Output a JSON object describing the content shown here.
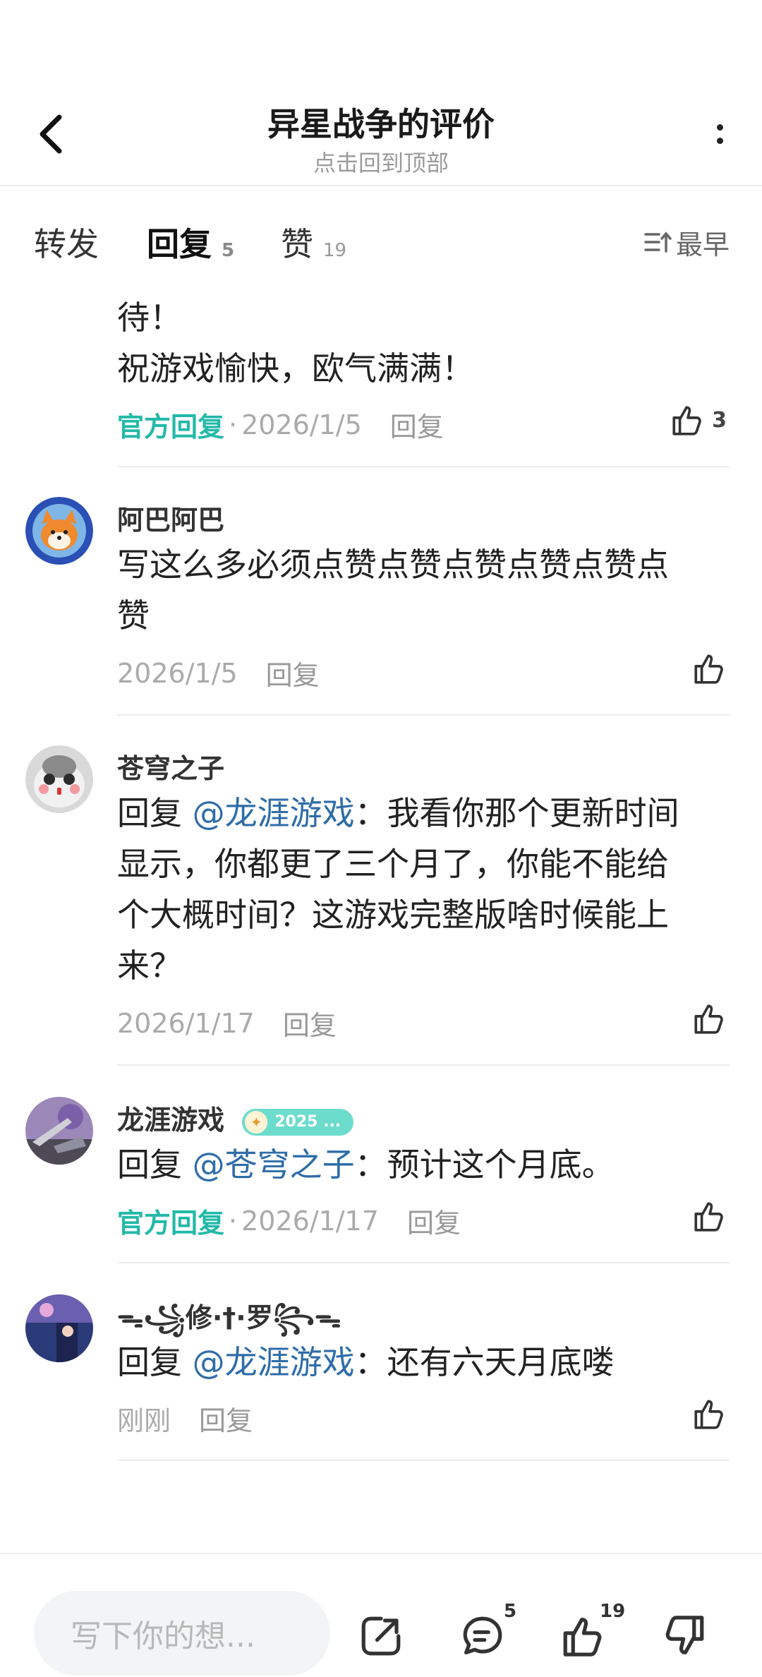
{
  "header": {
    "title": "异星战争的评价",
    "subtitle": "点击回到顶部"
  },
  "tabs": [
    {
      "label": "转发",
      "count": ""
    },
    {
      "label": "回复",
      "count": "5"
    },
    {
      "label": "赞",
      "count": "19"
    }
  ],
  "sort": {
    "label": "最早"
  },
  "comments": [
    {
      "text_lines": [
        "待！",
        "祝游戏愉快，欧气满满！"
      ],
      "official": "官方回复",
      "date": "2026/1/5",
      "reply": "回复",
      "likes": "3"
    },
    {
      "name": "阿巴阿巴",
      "text_lines": [
        "写这么多必须点赞点赞点赞点赞点赞点",
        "赞"
      ],
      "date": "2026/1/5",
      "reply": "回复"
    },
    {
      "name": "苍穹之子",
      "reply_prefix": "回复",
      "mention": "@龙涯游戏",
      "text_first": "：我看你那个更新时间",
      "text_lines": [
        "显示，你都更了三个月了，你能不能给",
        "个大概时间？这游戏完整版啥时候能上",
        "来？"
      ],
      "date": "2026/1/17",
      "reply": "回复"
    },
    {
      "name": "龙涯游戏",
      "badge": "2025 ...",
      "reply_prefix": "回复",
      "mention": "@苍穹之子",
      "text_first": "：预计这个月底。",
      "official": "官方回复",
      "date": "2026/1/17",
      "reply": "回复"
    },
    {
      "name": "ᯓ꧁修·†·罗꧂ᯓ",
      "reply_prefix": "回复",
      "mention": "@龙涯游戏",
      "text_first": "：还有六天月底喽",
      "date": "刚刚",
      "reply": "回复"
    }
  ],
  "bottom_bar": {
    "input_placeholder": "写下你的想...",
    "comment_count": "5",
    "like_count": "19"
  },
  "colors": {
    "accent": "#22b9a8",
    "mention": "#2e6da8"
  }
}
